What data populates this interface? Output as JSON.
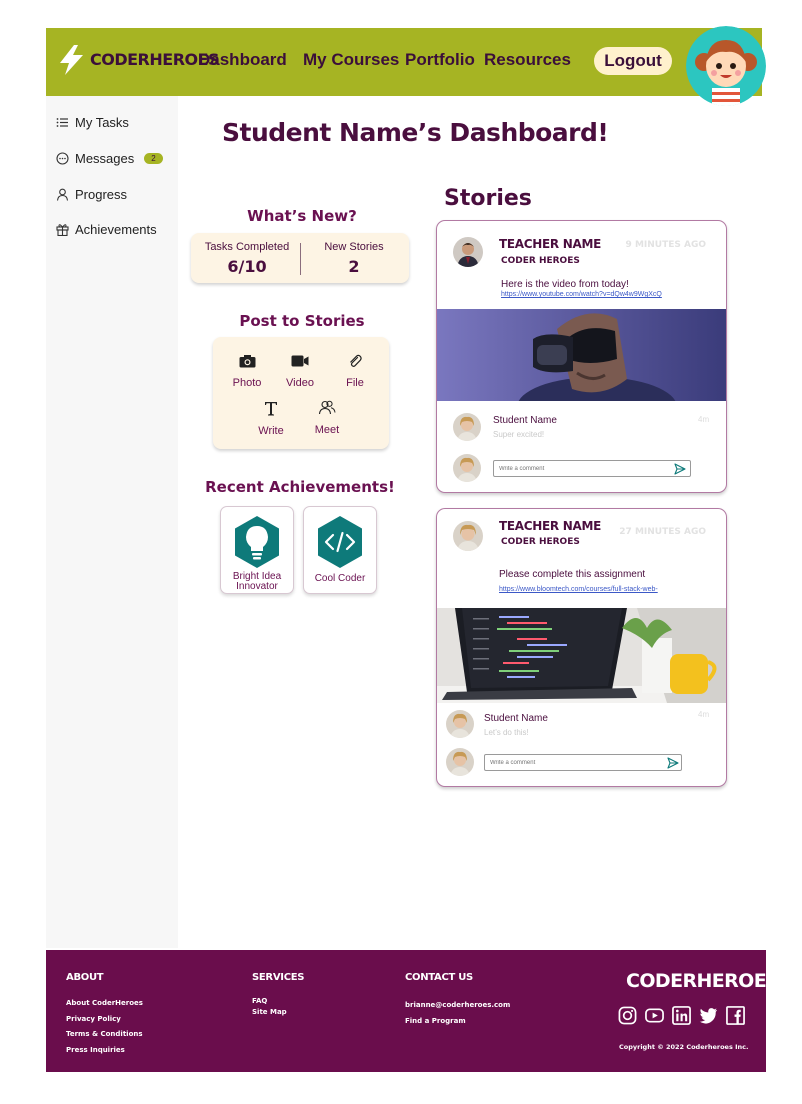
{
  "header": {
    "brand": "CODERHEROES",
    "nav": [
      "Dashboard",
      "My Courses",
      "Portfolio",
      "Resources"
    ],
    "logout_label": "Logout"
  },
  "sidebar": {
    "items": [
      {
        "label": "My Tasks",
        "icon": "list-icon"
      },
      {
        "label": "Messages",
        "icon": "chat-bubble-icon",
        "badge": "2"
      },
      {
        "label": "Progress",
        "icon": "person-icon"
      },
      {
        "label": "Achievements",
        "icon": "gift-icon"
      }
    ]
  },
  "main": {
    "title": "Student Name’s Dashboard!",
    "whats_new": {
      "heading": "What’s New?",
      "tasks_label": "Tasks Completed",
      "tasks_value": "6/10",
      "stories_label": "New Stories",
      "stories_value": "2"
    },
    "post": {
      "heading": "Post to Stories",
      "buttons": [
        {
          "label": "Photo",
          "icon": "camera-icon"
        },
        {
          "label": "Video",
          "icon": "video-camera-icon"
        },
        {
          "label": "File",
          "icon": "paperclip-icon"
        },
        {
          "label": "Write",
          "icon": "text-t-icon"
        },
        {
          "label": "Meet",
          "icon": "people-icon"
        }
      ]
    },
    "achievements": {
      "heading": "Recent Achievements!",
      "items": [
        {
          "label_line1": "Bright Idea",
          "label_line2": "Innovator",
          "icon": "lightbulb-icon"
        },
        {
          "label_line1": "Cool Coder",
          "label_line2": "",
          "icon": "code-brackets-icon"
        }
      ]
    }
  },
  "stories": {
    "heading": "Stories",
    "posts": [
      {
        "author": "TEACHER NAME",
        "org": "CODER HEROES",
        "time": "9 MINUTES AGO",
        "message": "Here is the video from today!",
        "link": "https://www.youtube.com/watch?v=dQw4w9WgXcQ",
        "image": "vr-headset-photo",
        "comment": {
          "name": "Student Name",
          "text": "Super excited!",
          "time": "4m"
        },
        "comment_placeholder": "Write a comment"
      },
      {
        "author": "TEACHER NAME",
        "org": "CODER HEROES",
        "time": "27 MINUTES AGO",
        "message": "Please complete this assignment",
        "link": "https://www.bloomtech.com/courses/full-stack-web-",
        "image": "laptop-code-photo",
        "comment": {
          "name": "Student Name",
          "text": "Let’s do this!",
          "time": "4m"
        },
        "comment_placeholder": "Write a comment"
      }
    ]
  },
  "footer": {
    "about": {
      "heading": "ABOUT",
      "links": [
        "About CoderHeroes",
        "Privacy Policy",
        "Terms & Conditions",
        "Press Inquiries"
      ]
    },
    "services": {
      "heading": "SERVICES",
      "links": [
        "FAQ",
        "Site Map"
      ]
    },
    "contact": {
      "heading": "CONTACT US",
      "links": [
        "brianne@coderheroes.com",
        "Find a Program"
      ]
    },
    "brand": "CODERHEROES",
    "social": [
      "instagram-icon",
      "youtube-icon",
      "linkedin-icon",
      "twitter-icon",
      "facebook-icon"
    ],
    "copyright": "Copyright © 2022 Coderheroes Inc."
  },
  "colors": {
    "header_bg": "#a6b423",
    "primary": "#4a0e3e",
    "accent_purple": "#6a1151",
    "card_bg": "#fdf4e4",
    "footer_bg": "#6a0d4c",
    "badge_teal": "#0e7a7a"
  }
}
